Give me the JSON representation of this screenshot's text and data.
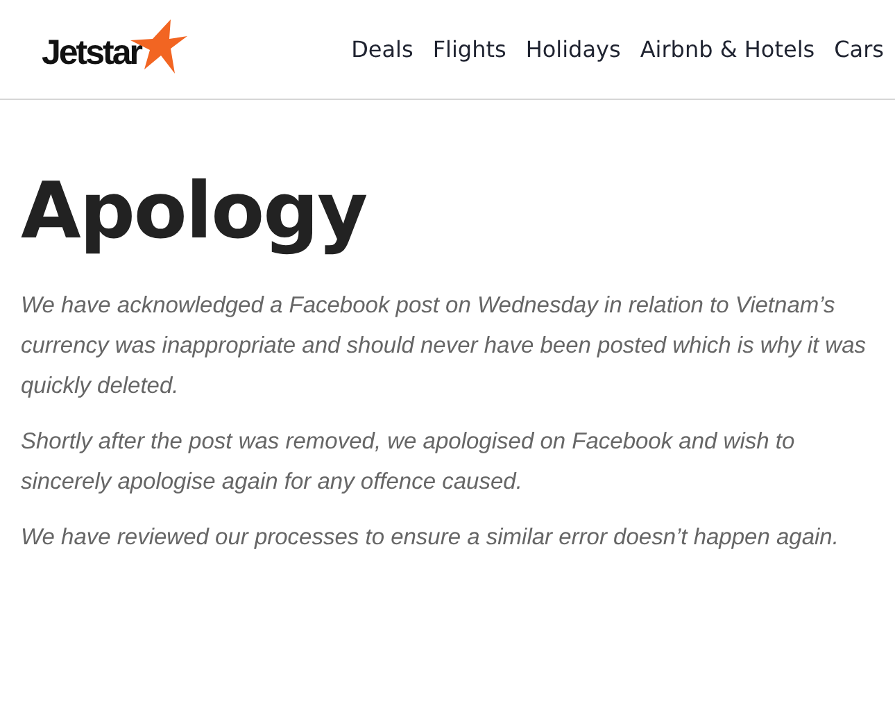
{
  "header": {
    "logo": "Jetstar",
    "nav": [
      {
        "label": "Deals"
      },
      {
        "label": "Flights"
      },
      {
        "label": "Holidays"
      },
      {
        "label": "Airbnb & Hotels"
      },
      {
        "label": "Cars"
      }
    ]
  },
  "heading": "Apology",
  "paragraphs": [
    "We have acknowledged a Facebook post on Wednesday in relation to Vietnam’s currency was inappropriate and should never have been posted which is why it was quickly deleted.",
    "Shortly after the post was removed, we apologised on Facebook and wish to sincerely apologise again for any offence caused.",
    "We have reviewed our processes to ensure a similar error doesn’t happen again."
  ]
}
